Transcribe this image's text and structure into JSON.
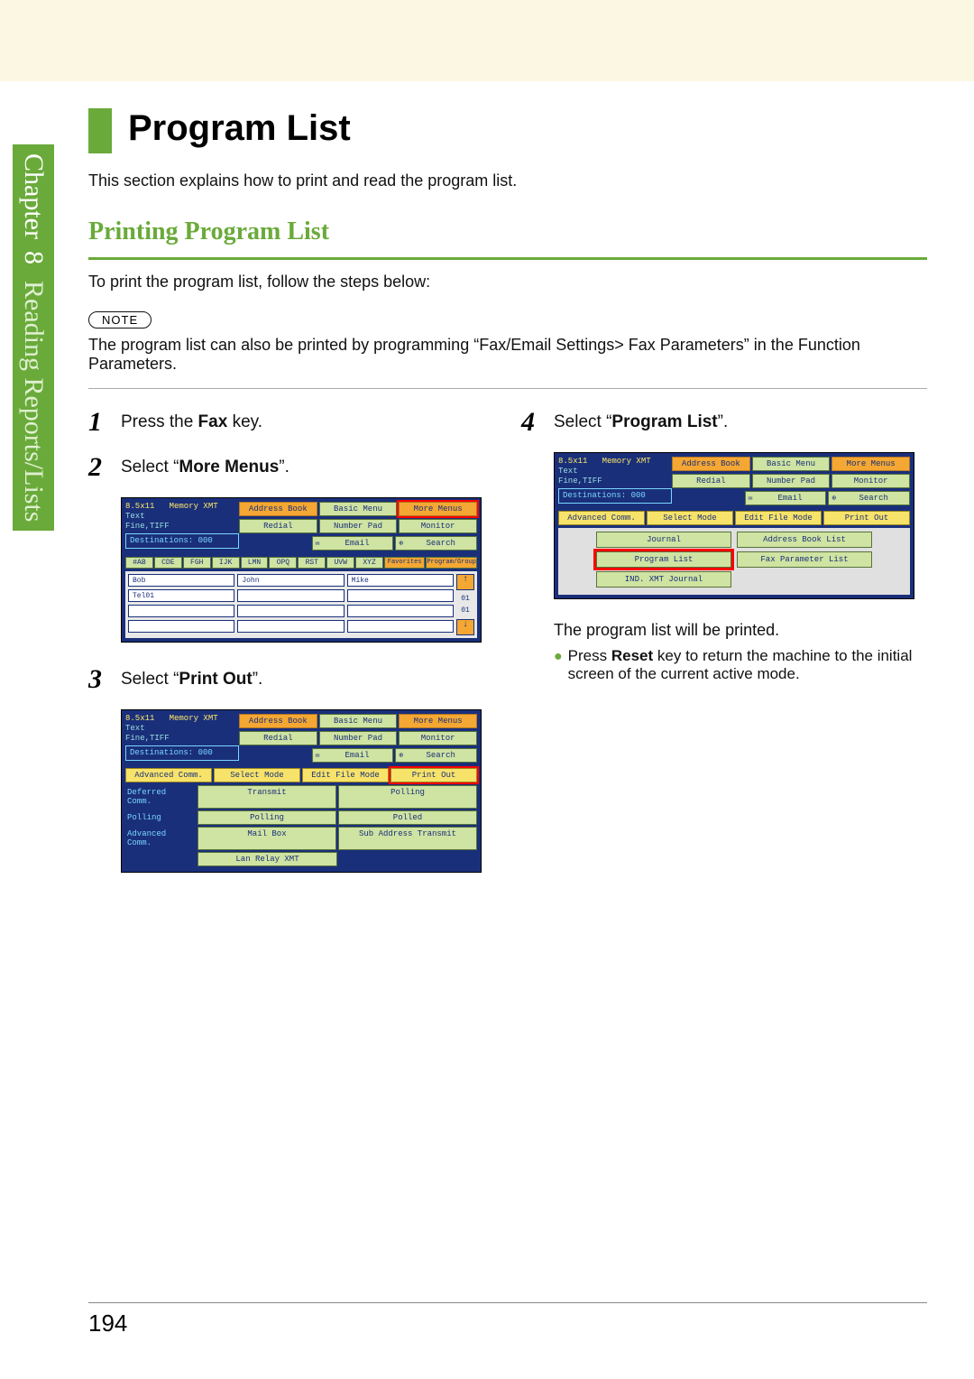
{
  "sidebar": {
    "chapter_word": "Chapter",
    "chapter_num": "8",
    "section": "Reading Reports/Lists"
  },
  "title": "Program List",
  "intro": "This section explains how to print and read the program list.",
  "section_heading": "Printing Program List",
  "section_lead": "To print the program list, follow the steps below:",
  "note_label": "NOTE",
  "note_text": "The program list can also be printed by programming “Fax/Email Settings> Fax Parameters” in the Function Parameters.",
  "steps": {
    "s1": {
      "num": "1",
      "pre": "Press the ",
      "bold": "Fax",
      "post": " key."
    },
    "s2": {
      "num": "2",
      "pre": "Select “",
      "bold": "More Menus",
      "post": "”."
    },
    "s3": {
      "num": "3",
      "pre": "Select “",
      "bold": "Print Out",
      "post": "”."
    },
    "s4": {
      "num": "4",
      "pre": "Select “",
      "bold": "Program List",
      "post": "”."
    }
  },
  "screen_common": {
    "paper": "8.5x11",
    "mem": "Memory XMT",
    "text": "Text",
    "fine": "Fine,TIFF",
    "dest": "Destinations: 000",
    "btns1": {
      "ab": "Address Book",
      "bm": "Basic Menu",
      "mm": "More Menus"
    },
    "btns2": {
      "rd": "Redial",
      "np": "Number Pad",
      "mo": "Monitor"
    },
    "btns3": {
      "em": "Email",
      "se": "Search"
    }
  },
  "screen2": {
    "alpha": [
      "#AB",
      "CDE",
      "FGH",
      "IJK",
      "LMN",
      "OPQ",
      "RST",
      "UVW",
      "XYZ"
    ],
    "fav": "Favorites",
    "prog": "Program/Group",
    "e1": "Bob",
    "e2": "John",
    "e3": "Mike",
    "e4": "Tel01",
    "scroll_top": "01",
    "scroll_bot": "01"
  },
  "screen3": {
    "y1": "Advanced Comm.",
    "y2": "Select Mode",
    "y3": "Edit File Mode",
    "y4": "Print Out",
    "r1l": "Deferred Comm.",
    "r1a": "Transmit",
    "r1b": "Polling",
    "r2l": "Polling",
    "r2a": "Polling",
    "r2b": "Polled",
    "r3l": "Advanced Comm.",
    "r3a": "Mail Box",
    "r3b": "Sub Address Transmit",
    "r4a": "Lan Relay XMT"
  },
  "screen4": {
    "y1": "Advanced Comm.",
    "y2": "Select Mode",
    "y3": "Edit File Mode",
    "y4": "Print Out",
    "l1a": "Journal",
    "l1b": "Address Book List",
    "l2a": "Program List",
    "l2b": "Fax Parameter List",
    "l3a": "IND. XMT Journal"
  },
  "post4_text": "The program list will be printed.",
  "post4_bullet_pre": "Press ",
  "post4_bullet_bold": "Reset",
  "post4_bullet_post": " key to return the machine to the initial screen of the current active mode.",
  "page_number": "194"
}
